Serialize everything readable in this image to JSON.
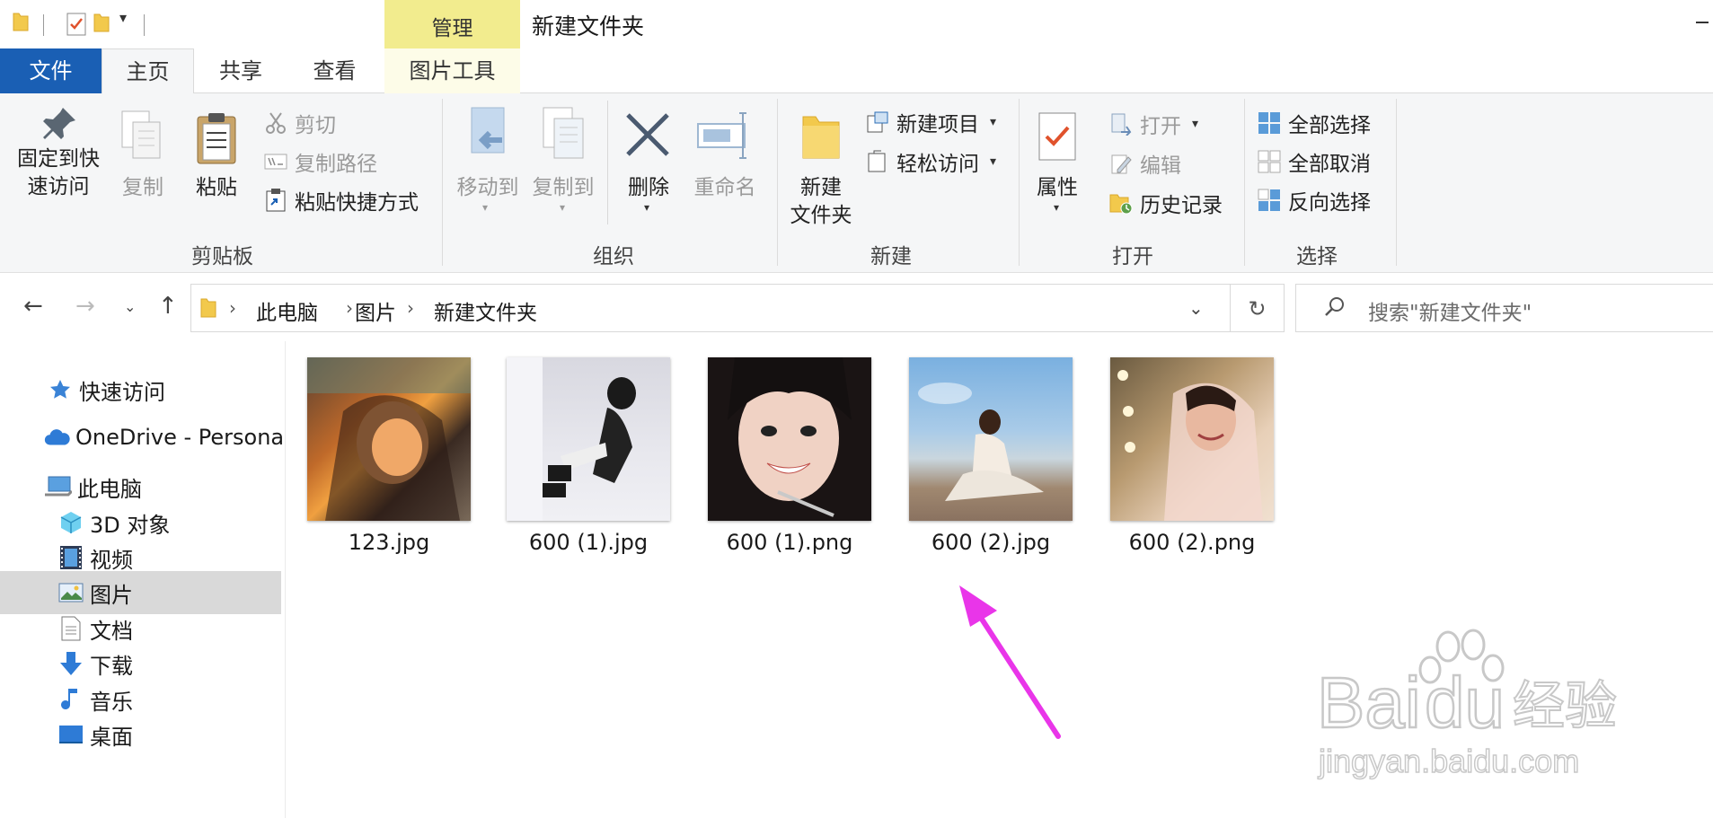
{
  "title_bar": {
    "title": "新建文件夹",
    "context_tab_header": "管理"
  },
  "tabs": {
    "file": "文件",
    "home": "主页",
    "share": "共享",
    "view": "查看",
    "picture_tools": "图片工具"
  },
  "ribbon": {
    "clipboard": {
      "label": "剪贴板",
      "pin": "固定到快\n速访问",
      "copy": "复制",
      "paste": "粘贴",
      "cut": "剪切",
      "copy_path": "复制路径",
      "paste_shortcut": "粘贴快捷方式"
    },
    "organize": {
      "label": "组织",
      "move_to": "移动到",
      "copy_to": "复制到",
      "delete": "删除",
      "rename": "重命名"
    },
    "new": {
      "label": "新建",
      "new_folder": "新建\n文件夹",
      "new_item": "新建项目",
      "easy_access": "轻松访问"
    },
    "open": {
      "label": "打开",
      "properties": "属性",
      "open": "打开",
      "edit": "编辑",
      "history": "历史记录"
    },
    "select": {
      "label": "选择",
      "select_all": "全部选择",
      "select_none": "全部取消",
      "invert": "反向选择"
    }
  },
  "address": {
    "crumbs": [
      "此电脑",
      "图片",
      "新建文件夹"
    ],
    "search_placeholder": "搜索\"新建文件夹\""
  },
  "sidebar": {
    "quick_access": "快速访问",
    "onedrive": "OneDrive - Persona",
    "this_pc": "此电脑",
    "objects3d": "3D 对象",
    "videos": "视频",
    "pictures": "图片",
    "documents": "文档",
    "downloads": "下载",
    "music": "音乐",
    "desktop": "桌面"
  },
  "files": [
    {
      "name": "123.jpg"
    },
    {
      "name": "600 (1).jpg"
    },
    {
      "name": "600 (1).png"
    },
    {
      "name": "600 (2).jpg"
    },
    {
      "name": "600 (2).png"
    }
  ],
  "colors": {
    "file_tab": "#1a5fb4",
    "context_header": "#f2ec8e",
    "annotation_arrow": "#e935e9",
    "selected_nav": "#d9d9d9"
  },
  "watermark": {
    "logo": "Baidu经验",
    "url": "jingyan.baidu.com"
  }
}
